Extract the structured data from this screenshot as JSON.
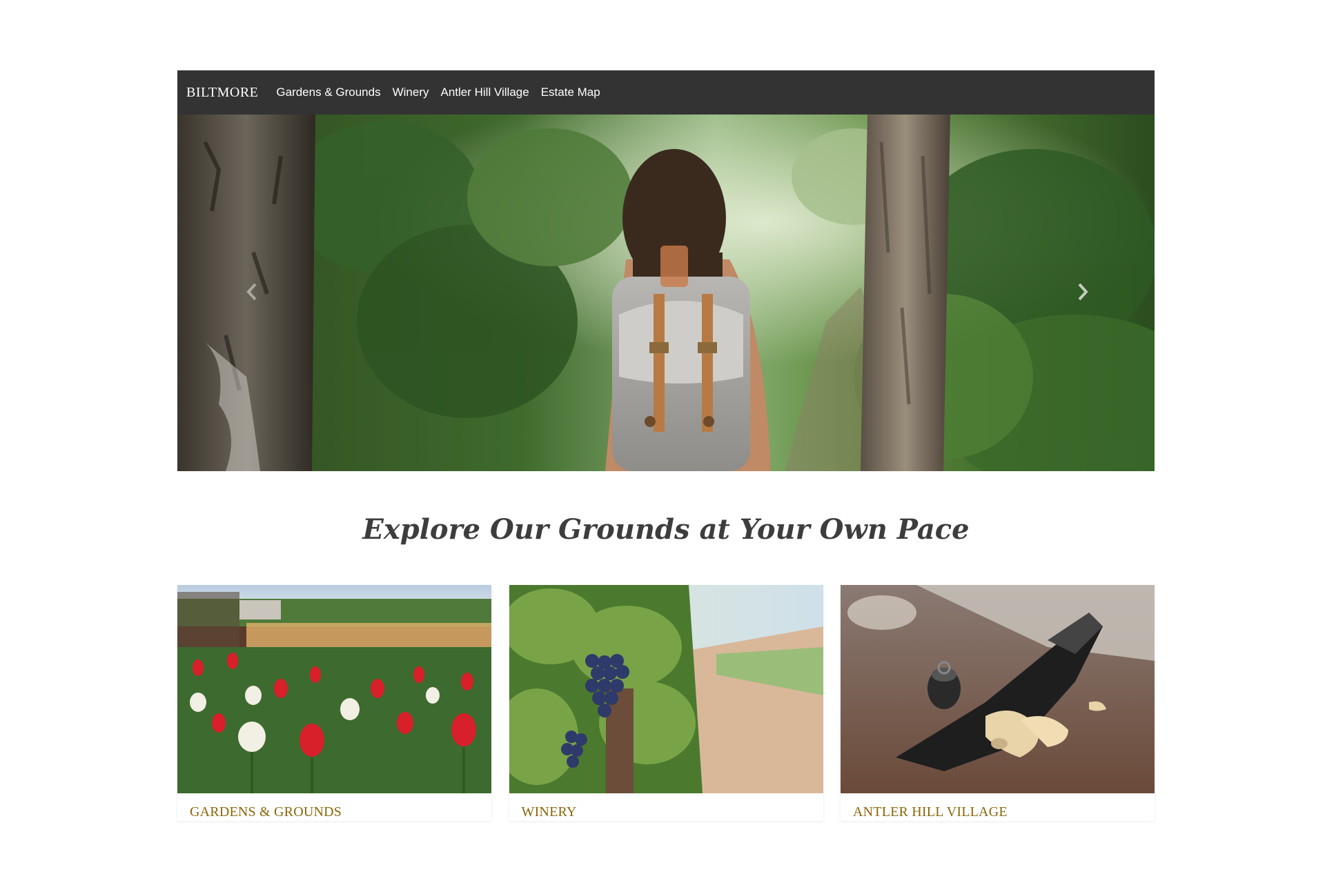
{
  "navbar": {
    "brand": "BILTMORE",
    "items": [
      {
        "label": "Gardens & Grounds"
      },
      {
        "label": "Winery"
      },
      {
        "label": "Antler Hill Village"
      },
      {
        "label": "Estate Map"
      }
    ]
  },
  "hero": {
    "prev_icon": "chevron-left-icon",
    "next_icon": "chevron-right-icon"
  },
  "section": {
    "title": "Explore Our Grounds at Your Own Pace"
  },
  "cards": [
    {
      "title": "GARDENS & GROUNDS"
    },
    {
      "title": "WINERY"
    },
    {
      "title": "ANTLER HILL VILLAGE"
    }
  ],
  "colors": {
    "navbar_bg": "#333333",
    "card_title": "#8b6508",
    "heading": "#3d3d3d"
  }
}
